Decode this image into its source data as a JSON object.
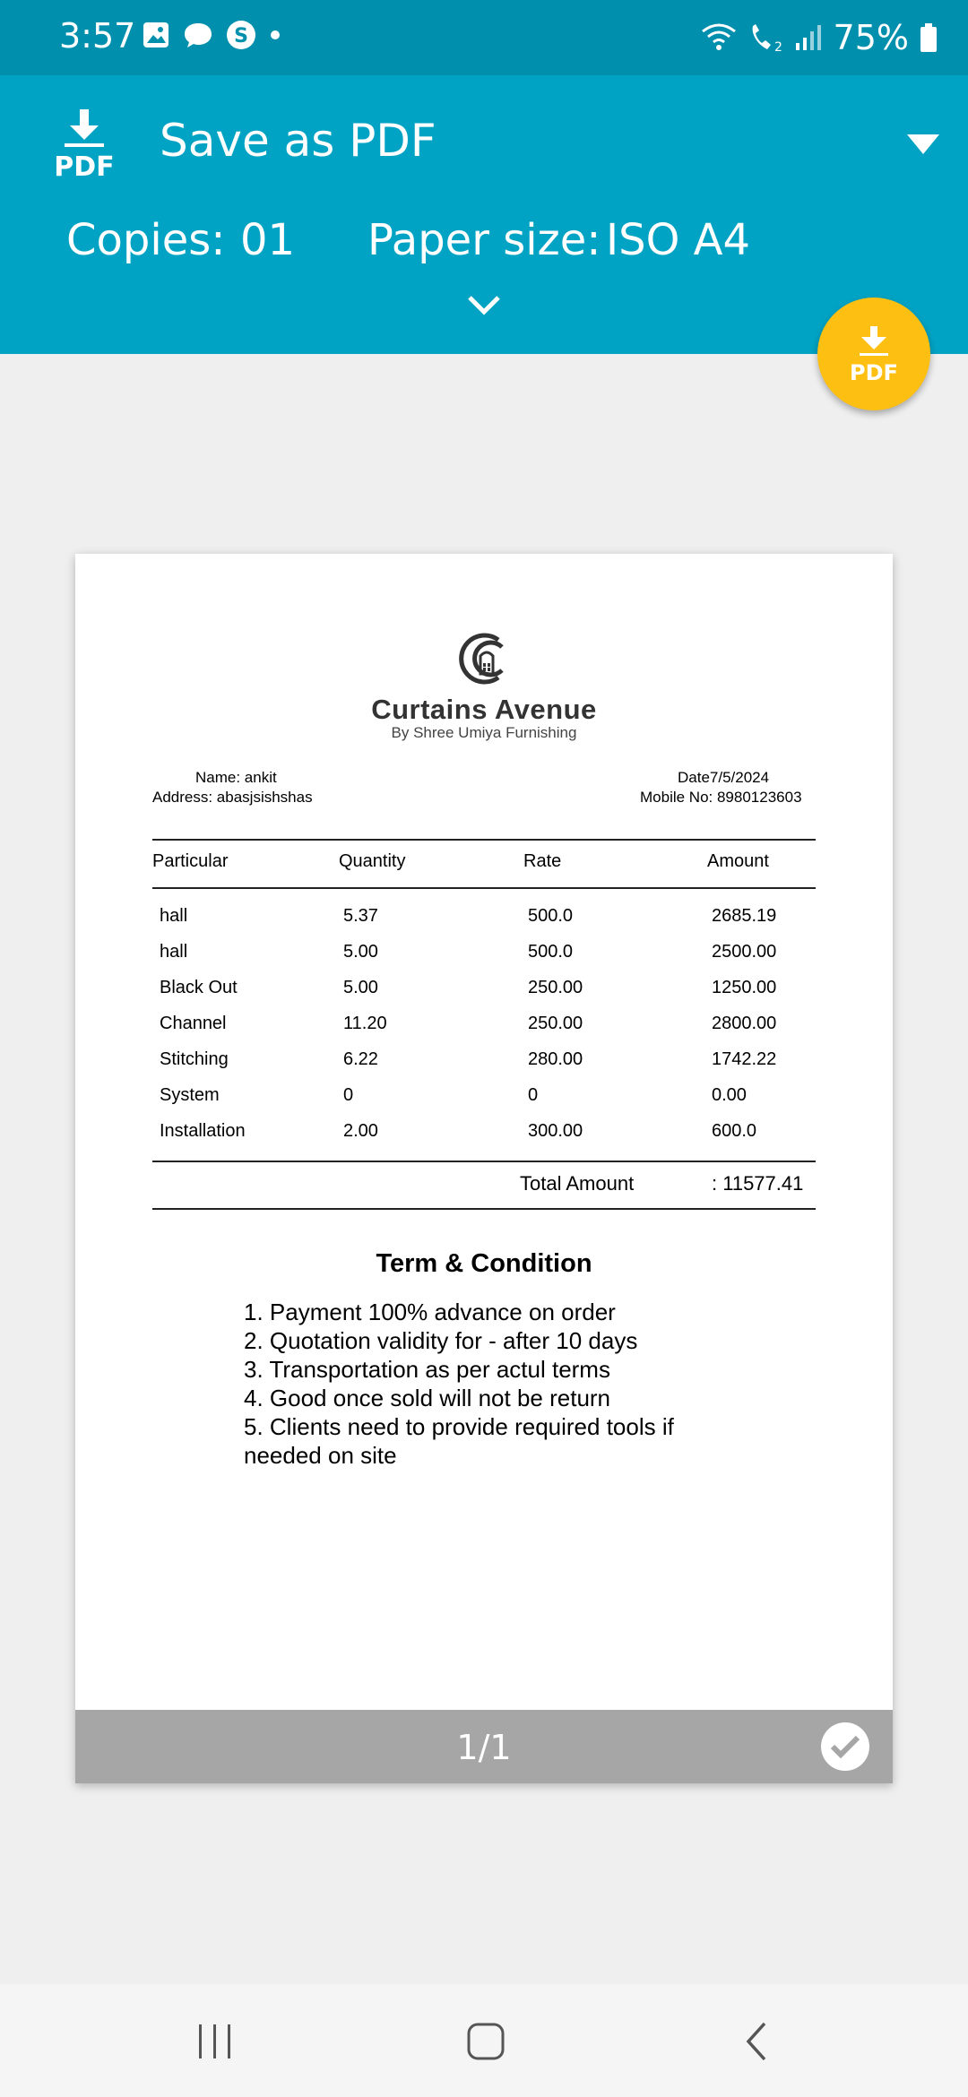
{
  "status_bar": {
    "time": "3:57",
    "battery": "75%",
    "left_icons": [
      "gallery-icon",
      "chat-icon",
      "skype-icon",
      "dot-icon"
    ],
    "right_icons": [
      "wifi-icon",
      "wifi-calling-icon",
      "signal-icon",
      "battery-icon"
    ]
  },
  "header": {
    "pdf_icon_label": "PDF",
    "title": "Save as PDF",
    "copies_label": "Copies:",
    "copies_value": "01",
    "paper_label": "Paper size:",
    "paper_value": "ISO A4"
  },
  "fab": {
    "label": "PDF"
  },
  "document": {
    "company_name": "Curtains Avenue",
    "company_sub": "By Shree Umiya Furnishing",
    "customer_name": "Name: ankit",
    "customer_address": "Address: abasjsishshas",
    "date": "Date7/5/2024",
    "mobile": "Mobile No: 8980123603",
    "table": {
      "headers": [
        "Particular",
        "Quantity",
        "Rate",
        "Amount"
      ],
      "rows": [
        [
          "hall",
          "5.37",
          "500.0",
          "2685.19"
        ],
        [
          "hall",
          "5.00",
          "500.0",
          "2500.00"
        ],
        [
          "Black Out",
          "5.00",
          "250.00",
          "1250.00"
        ],
        [
          "Channel",
          "11.20",
          "250.00",
          "2800.00"
        ],
        [
          "Stitching",
          "6.22",
          "280.00",
          "1742.22"
        ],
        [
          "System",
          "0",
          "0",
          "0.00"
        ],
        [
          "Installation",
          "2.00",
          "300.00",
          "600.0"
        ]
      ]
    },
    "total_label": "Total Amount",
    "total_value": ": 11577.41",
    "terms_title": "Term & Condition",
    "terms": [
      "1. Payment 100% advance on order",
      "2. Quotation validity for - after 10 days",
      "3. Transportation as per actul terms",
      "4. Good once sold will not be return",
      "5. Clients need to provide required tools if needed on site"
    ]
  },
  "page_footer": {
    "page_count": "1/1"
  },
  "colors": {
    "status_bar": "#0090ad",
    "header": "#00a3c4",
    "fab": "#fdc012",
    "page_footer": "#a6a6a6"
  }
}
